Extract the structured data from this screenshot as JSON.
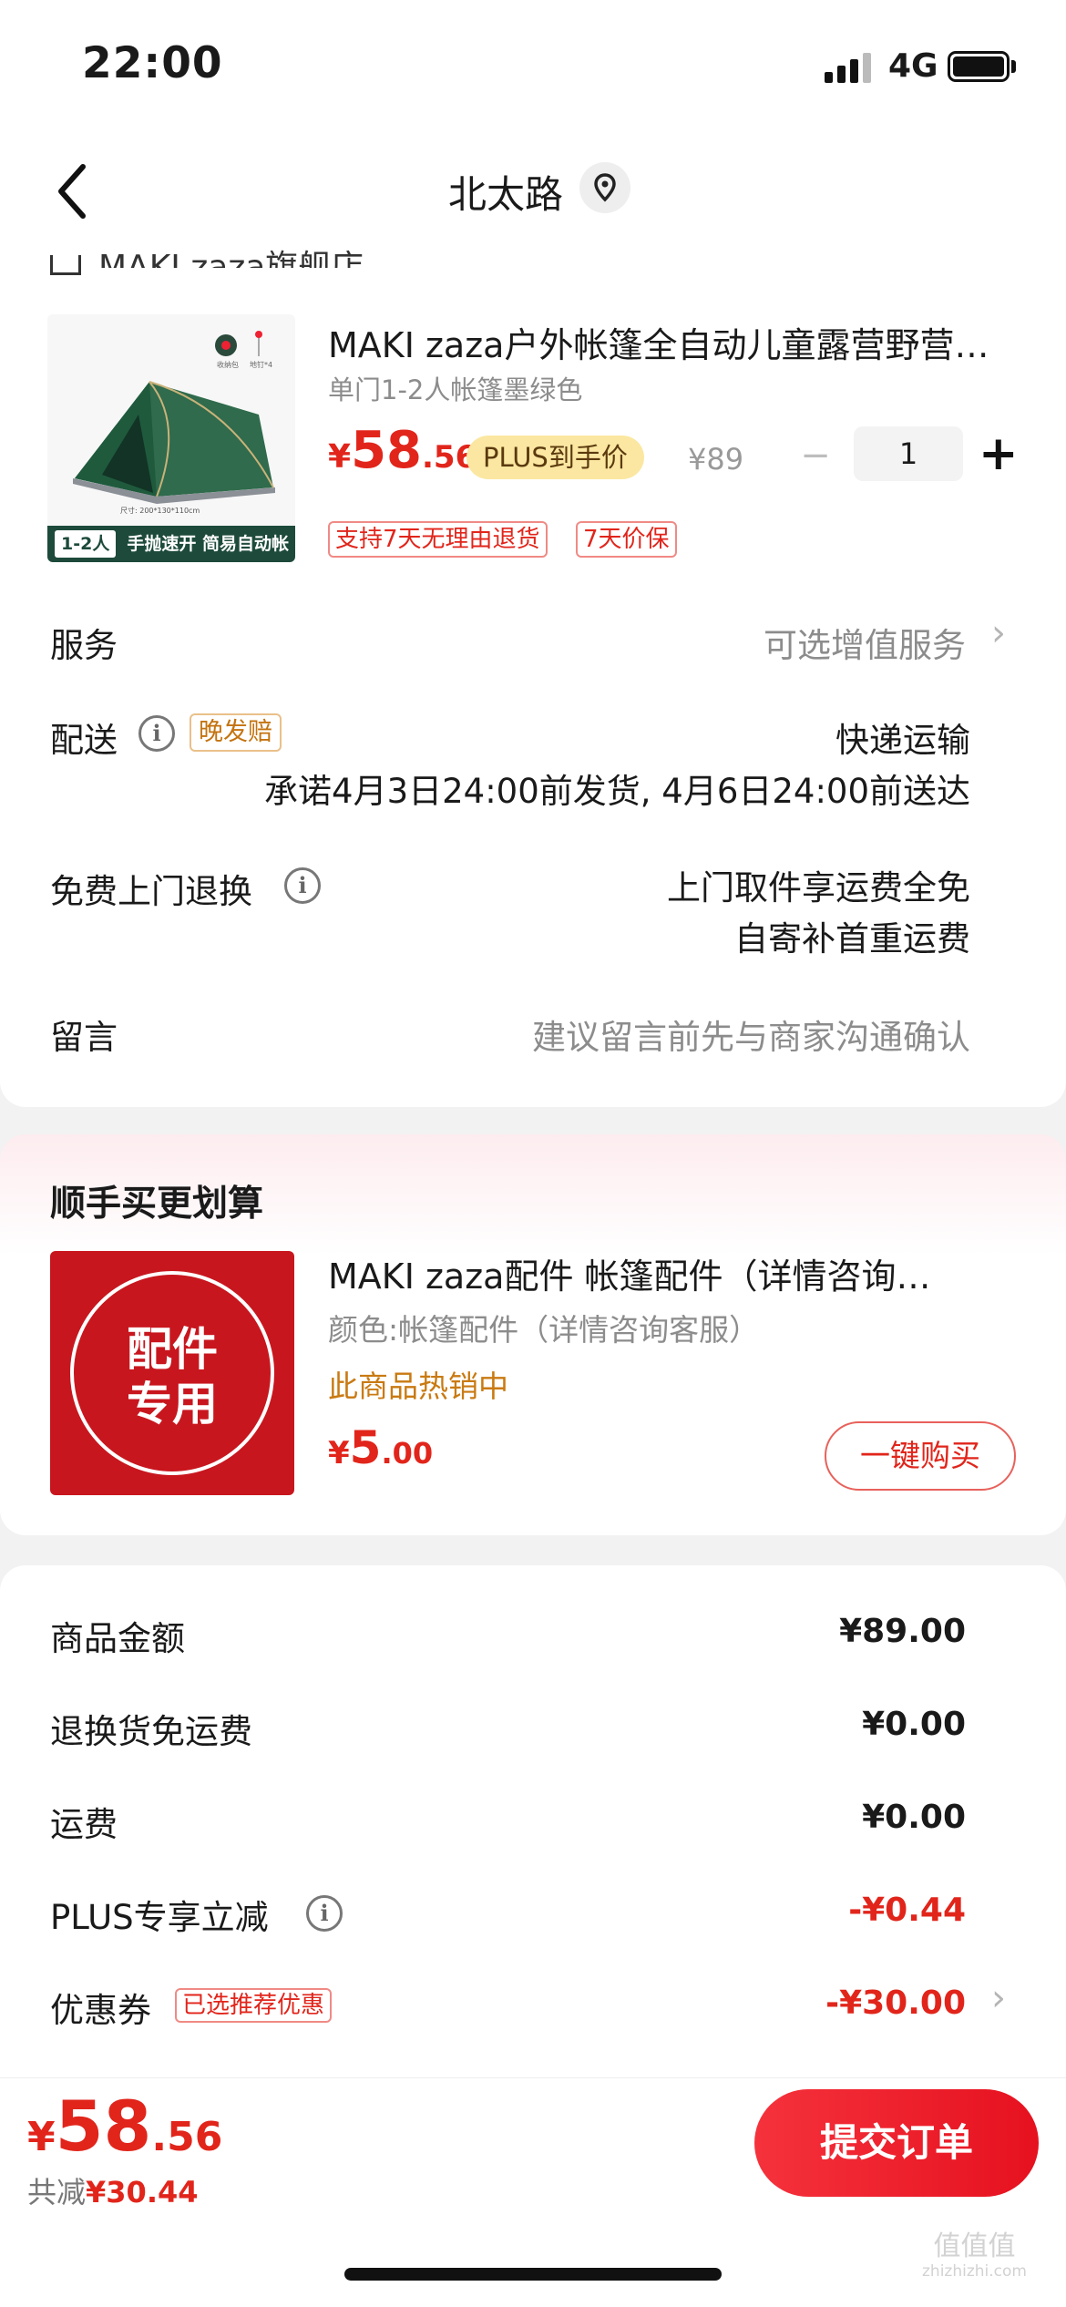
{
  "status_bar": {
    "time": "22:00",
    "network": "4G"
  },
  "nav": {
    "title": "北太路",
    "back_icon": "chevron-left-icon",
    "location_icon": "location-pin-icon"
  },
  "shop": {
    "name": "MAKI zaza旗舰店"
  },
  "product": {
    "title": "MAKI zaza户外帐篷全自动儿童露营野营…",
    "spec": "单门1-2人帐篷墨绿色",
    "price_currency": "¥",
    "price_int": "58",
    "price_dec": ".56",
    "plus_badge": "PLUS到手价",
    "original_price": "¥89",
    "quantity": "1",
    "minus": "−",
    "plus": "+",
    "tags": [
      "支持7天无理由退货",
      "7天价保"
    ],
    "image_banner_badge": "1-2人",
    "image_banner_text": "手抛速开 简易自动帐",
    "image_size_text": "尺寸: 200*130*110cm"
  },
  "rows": {
    "service_label": "服务",
    "service_value": "可选增值服务",
    "delivery_label": "配送",
    "delivery_tag": "晚发赔",
    "delivery_method": "快递运输",
    "delivery_promise": "承诺4月3日24:00前发货, 4月6日24:00前送达",
    "return_label": "免费上门退换",
    "return_line1": "上门取件享运费全免",
    "return_line2": "自寄补首重运费",
    "message_label": "留言",
    "message_placeholder": "建议留言前先与商家沟通确认",
    "chevron": "›"
  },
  "recommend": {
    "heading": "顺手买更划算",
    "img_line1": "配件",
    "img_line2": "专用",
    "title": "MAKI zaza配件 帐篷配件（详情咨询…",
    "spec": "颜色:帐篷配件（详情咨询客服）",
    "hot": "此商品热销中",
    "price_currency": "¥",
    "price_int": "5",
    "price_dec": ".00",
    "button": "一键购买"
  },
  "summary": {
    "goods_label": "商品金额",
    "goods_value": "¥89.00",
    "return_free_label": "退换货免运费",
    "return_free_value": "¥0.00",
    "shipping_label": "运费",
    "shipping_value": "¥0.00",
    "plus_label": "PLUS专享立减",
    "plus_value": "-¥0.44",
    "coupon_label": "优惠券",
    "coupon_tag": "已选推荐优惠",
    "coupon_value": "-¥30.00"
  },
  "footer": {
    "total_currency": "¥",
    "total_int": "58",
    "total_dec": ".56",
    "save_label": "共减",
    "save_value": "¥30.44",
    "submit": "提交订单",
    "watermark": "值值值",
    "watermark_url": "zhizhizhi.com"
  },
  "colors": {
    "accent_red": "#e1251b",
    "tent_green": "#1d4a3b",
    "plus_gold": "#fbe7a1"
  }
}
